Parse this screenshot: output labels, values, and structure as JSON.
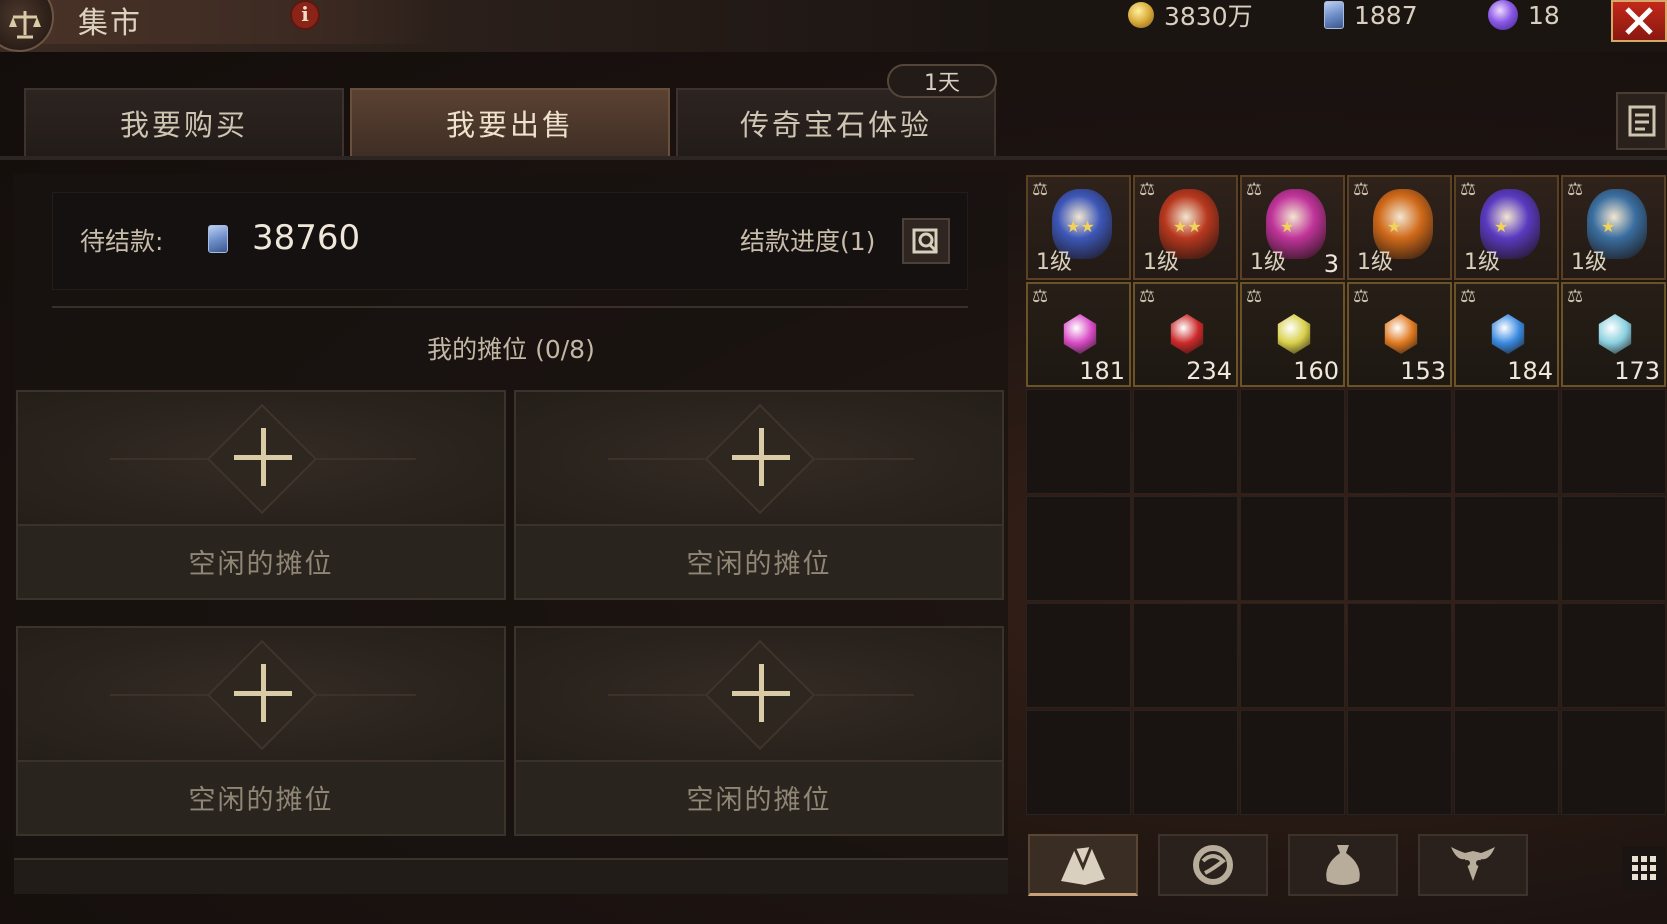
{
  "header": {
    "title": "集市",
    "info_icon": "info-icon",
    "currencies": [
      {
        "icon": "gold-coin-icon",
        "value": "3830万"
      },
      {
        "icon": "scroll-currency-icon",
        "value": "1887"
      },
      {
        "icon": "purple-orb-icon",
        "value": "18"
      }
    ],
    "close_icon": "close-icon"
  },
  "tabs": [
    {
      "label": "我要购买",
      "active": false
    },
    {
      "label": "我要出售",
      "active": true
    },
    {
      "label": "传奇宝石体验",
      "active": false
    }
  ],
  "timer_badge": "1天",
  "settlement": {
    "label": "待结款:",
    "value": "38760",
    "progress_label": "结款进度(1)"
  },
  "stalls": {
    "title": "我的摊位 (0/8)",
    "slots": [
      {
        "label": "空闲的摊位"
      },
      {
        "label": "空闲的摊位"
      },
      {
        "label": "空闲的摊位"
      },
      {
        "label": "空闲的摊位"
      }
    ]
  },
  "inventory": {
    "legendary_gems": [
      {
        "level": "1级",
        "count": "",
        "stars": "★★",
        "color": "#3d57b8"
      },
      {
        "level": "1级",
        "count": "",
        "stars": "★★",
        "color": "#b8381e"
      },
      {
        "level": "1级",
        "count": "3",
        "stars": "★",
        "color": "#c0349a"
      },
      {
        "level": "1级",
        "count": "",
        "stars": "★",
        "color": "#d06a1a"
      },
      {
        "level": "1级",
        "count": "",
        "stars": "★",
        "color": "#5a3ac0"
      },
      {
        "level": "1级",
        "count": "",
        "stars": "★",
        "color": "#3a6ea0"
      }
    ],
    "gems": [
      {
        "count": "181",
        "color": "#d84cc6"
      },
      {
        "count": "234",
        "color": "#cc2a2a"
      },
      {
        "count": "160",
        "color": "#d8d04a"
      },
      {
        "count": "153",
        "color": "#e07a22"
      },
      {
        "count": "184",
        "color": "#3a8ae0"
      },
      {
        "count": "173",
        "color": "#8ad0e0"
      }
    ]
  },
  "bag_tabs": [
    {
      "icon": "gem-bag-icon",
      "active": true
    },
    {
      "icon": "rune-bag-icon",
      "active": false
    },
    {
      "icon": "pouch-icon",
      "active": false
    },
    {
      "icon": "demon-mask-icon",
      "active": false
    }
  ]
}
